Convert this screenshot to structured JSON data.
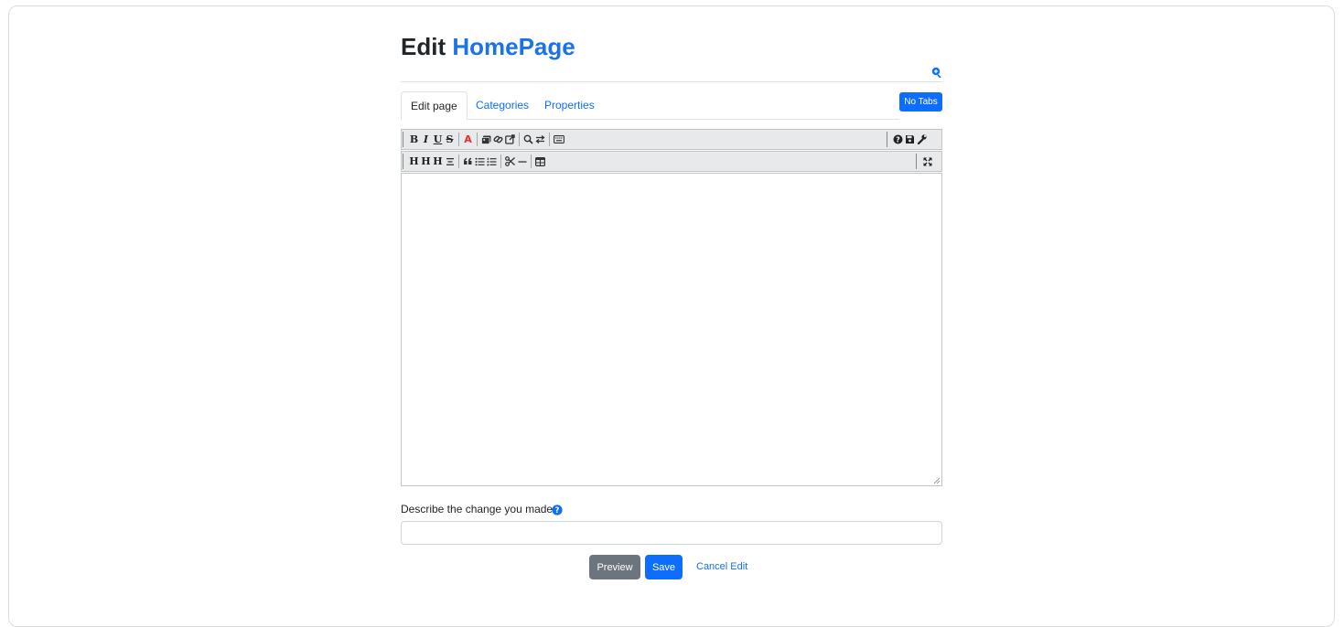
{
  "header": {
    "title_prefix": "Edit",
    "page_name": "HomePage"
  },
  "tabs": [
    {
      "label": "Edit page",
      "active": true
    },
    {
      "label": "Categories",
      "active": false
    },
    {
      "label": "Properties",
      "active": false
    }
  ],
  "no_tabs_label": "No Tabs",
  "toolbar": {
    "row1_left": [
      "bold-icon",
      "italic-icon",
      "underline-icon",
      "strikethrough-icon",
      "text-color-icon",
      "image-icon",
      "link-icon",
      "external-link-icon",
      "find-icon",
      "replace-icon",
      "keyboard-icon"
    ],
    "row1_right": [
      "help-icon",
      "save-icon",
      "settings-wrench-icon"
    ],
    "row2_left": [
      "heading-1-icon",
      "heading-2-icon",
      "heading-3-icon",
      "align-center-icon",
      "blockquote-icon",
      "unordered-list-icon",
      "ordered-list-icon",
      "cut-icon",
      "horizontal-rule-icon",
      "table-icon"
    ],
    "row2_right": [
      "fullscreen-icon"
    ],
    "glyphs": {
      "bold": "B",
      "italic": "I",
      "underline": "U",
      "strike": "S",
      "text_color": "A",
      "heading": "H"
    }
  },
  "editor": {
    "content": ""
  },
  "describe": {
    "label": "Describe the change you made",
    "value": "",
    "placeholder": ""
  },
  "actions": {
    "preview_label": "Preview",
    "save_label": "Save",
    "cancel_label": "Cancel Edit"
  },
  "colors": {
    "primary": "#0d6efd",
    "secondary": "#6c757d",
    "toolbar_bg": "#e8e9eb",
    "text_color_glyph": "#e03030"
  }
}
